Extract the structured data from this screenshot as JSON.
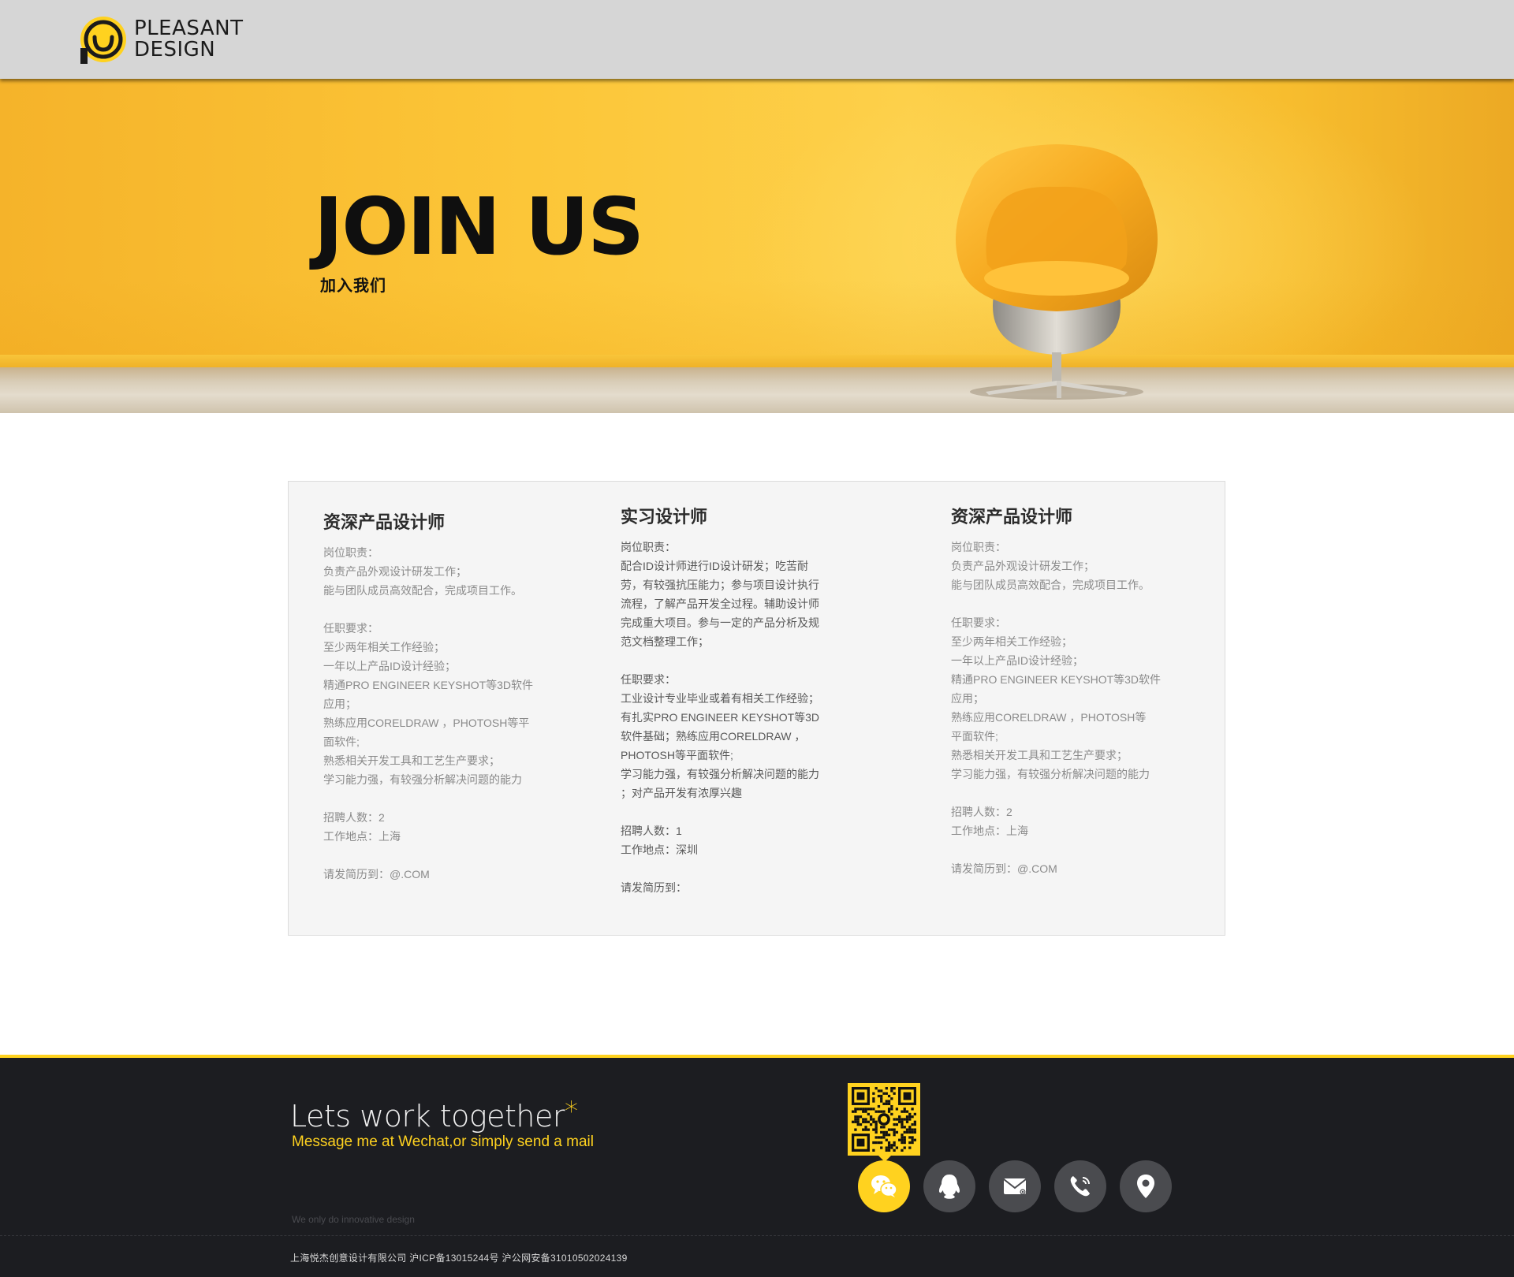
{
  "brand": {
    "line1": "PLEASANT",
    "line2": "DESIGN",
    "accent": "#ffd21f"
  },
  "hero": {
    "title": "JOIN US",
    "subtitle": "加入我们"
  },
  "jobs": [
    {
      "title": "资深产品设计师",
      "lines": [
        "岗位职责：",
        "负责产品外观设计研发工作；",
        "能与团队成员高效配合，完成项目工作。",
        "",
        "任职要求：",
        "至少两年相关工作经验；",
        "一年以上产品ID设计经验；",
        "精通PRO ENGINEER KEYSHOT等3D软件应用；",
        "熟练应用CORELDRAW ，PHOTOSH等平面软件;",
        "熟悉相关开发工具和工艺生产要求；",
        "学习能力强，有较强分析解决问题的能力",
        "",
        "招聘人数：2",
        "工作地点：上海",
        "",
        "请发简历到：@.COM"
      ]
    },
    {
      "title": "实习设计师",
      "lines": [
        "岗位职责：",
        "配合ID设计师进行ID设计研发；吃苦耐",
        "劳，有较强抗压能力；参与项目设计执行",
        "流程，了解产品开发全过程。辅助设计师",
        "完成重大项目。参与一定的产品分析及规",
        "范文档整理工作；",
        "",
        "任职要求：",
        "工业设计专业毕业或着有相关工作经验；",
        "有扎实PRO ENGINEER KEYSHOT等3D",
        "软件基础；熟练应用CORELDRAW ，",
        "PHOTOSH等平面软件;",
        "学习能力强，有较强分析解决问题的能力",
        "；对产品开发有浓厚兴趣",
        "",
        "招聘人数：1",
        "工作地点：深圳",
        "",
        "请发简历到："
      ]
    },
    {
      "title": "资深产品设计师",
      "lines": [
        "岗位职责：",
        "负责产品外观设计研发工作；",
        "能与团队成员高效配合，完成项目工作。",
        "",
        "任职要求：",
        "至少两年相关工作经验；",
        "一年以上产品ID设计经验；",
        "精通PRO ENGINEER KEYSHOT等3D软件",
        "应用；",
        "熟练应用CORELDRAW ，PHOTOSH等",
        "平面软件;",
        "熟悉相关开发工具和工艺生产要求；",
        "学习能力强，有较强分析解决问题的能力",
        "",
        "招聘人数：2",
        "工作地点：上海",
        "",
        "请发简历到：@.COM"
      ]
    }
  ],
  "footer": {
    "heading": "Lets work together",
    "star": "*",
    "sub": "Message me at Wechat,or simply send a mail",
    "tagline": "We only do innovative design",
    "legal": "上海悦杰创意设计有限公司 沪ICP备13015244号 沪公网安备31010502024139",
    "social": [
      {
        "icon": "wechat-icon",
        "active": true
      },
      {
        "icon": "qq-icon",
        "active": false
      },
      {
        "icon": "mail-icon",
        "active": false
      },
      {
        "icon": "phone-icon",
        "active": false
      },
      {
        "icon": "location-icon",
        "active": false
      }
    ]
  }
}
